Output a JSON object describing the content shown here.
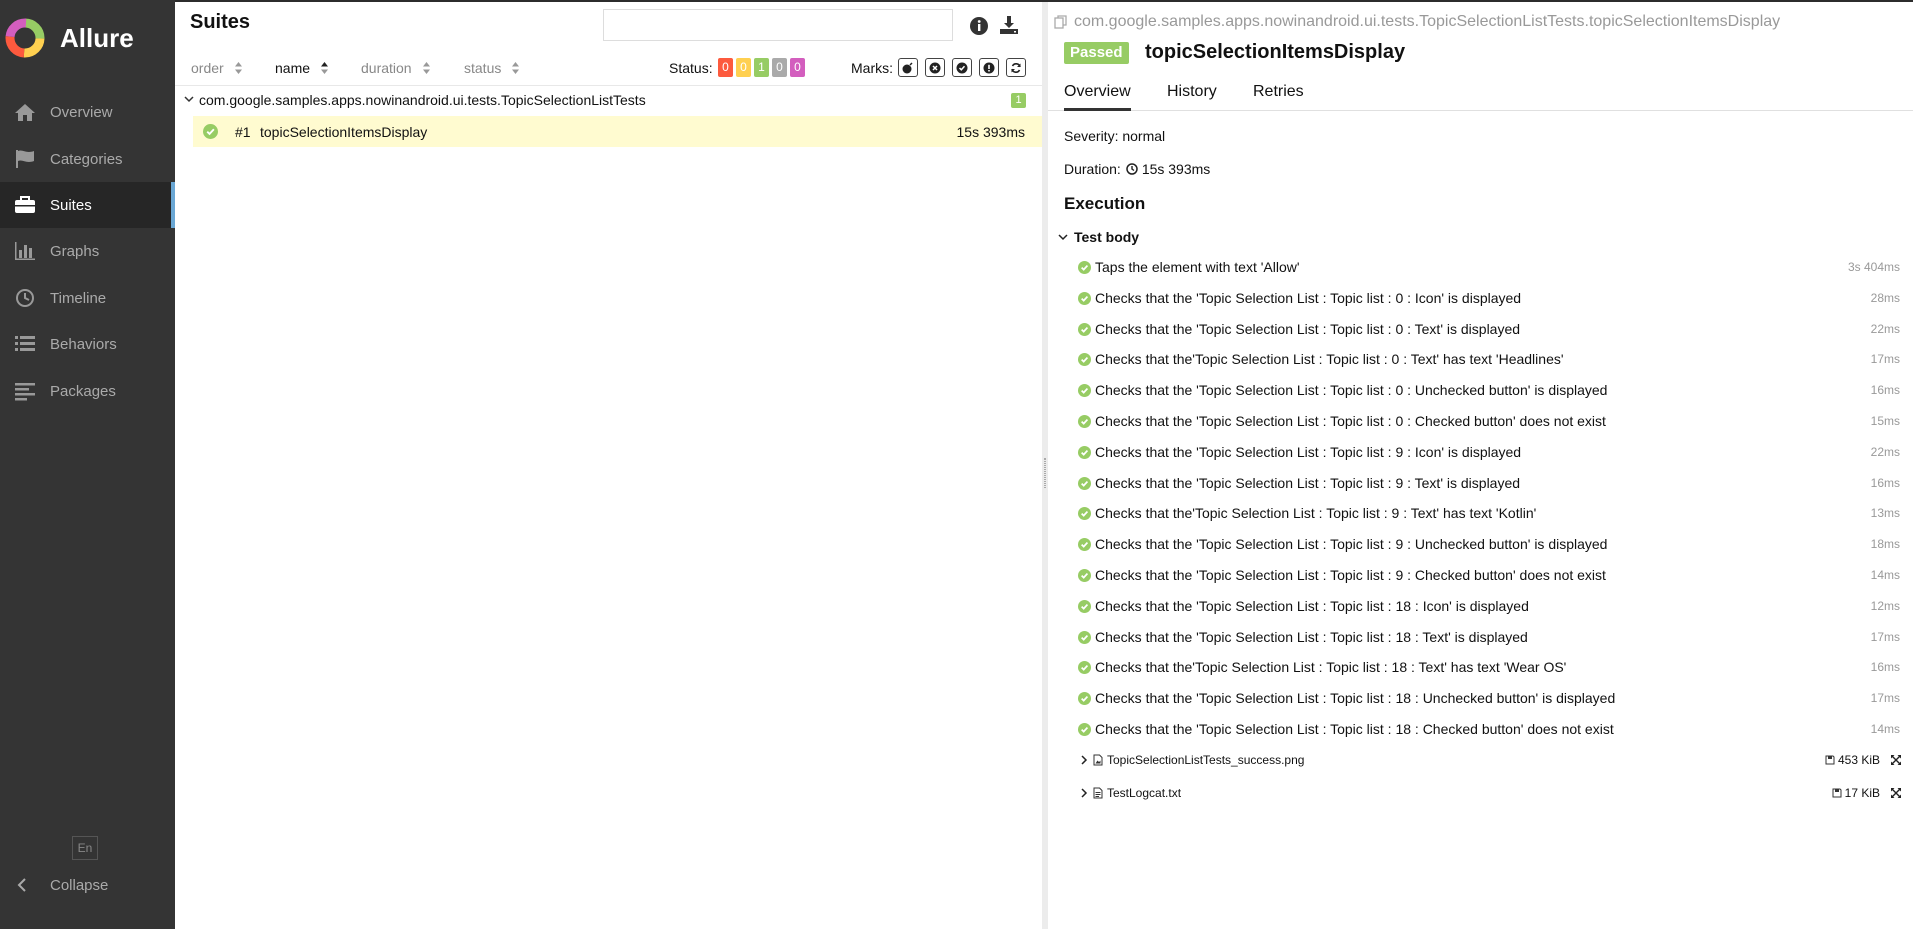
{
  "brand": {
    "name": "Allure"
  },
  "sidebar": {
    "items": [
      {
        "label": "Overview",
        "icon": "home-icon"
      },
      {
        "label": "Categories",
        "icon": "flag-icon"
      },
      {
        "label": "Suites",
        "icon": "briefcase-icon",
        "active": true
      },
      {
        "label": "Graphs",
        "icon": "bar-chart-icon"
      },
      {
        "label": "Timeline",
        "icon": "clock-icon"
      },
      {
        "label": "Behaviors",
        "icon": "list-icon"
      },
      {
        "label": "Packages",
        "icon": "align-left-icon"
      }
    ],
    "language": "En",
    "collapse_label": "Collapse"
  },
  "suites": {
    "title": "Suites",
    "search_value": "",
    "sort": {
      "order": "order",
      "name": "name",
      "duration": "duration",
      "status": "status"
    },
    "status_label": "Status:",
    "status_counts": [
      {
        "value": "0",
        "color": "#fd5a3e"
      },
      {
        "value": "0",
        "color": "#ffd050"
      },
      {
        "value": "1",
        "color": "#97cc64"
      },
      {
        "value": "0",
        "color": "#aaaaaa"
      },
      {
        "value": "0",
        "color": "#d35ebe"
      }
    ],
    "marks_label": "Marks:",
    "suite_name": "com.google.samples.apps.nowinandroid.ui.tests.TopicSelectionListTests",
    "suite_count": "1",
    "test": {
      "num": "#1",
      "name": "topicSelectionItemsDisplay",
      "duration": "15s 393ms"
    }
  },
  "detail": {
    "path": "com.google.samples.apps.nowinandroid.ui.tests.TopicSelectionListTests.topicSelectionItemsDisplay",
    "status": "Passed",
    "title": "topicSelectionItemsDisplay",
    "tabs": [
      "Overview",
      "History",
      "Retries"
    ],
    "severity": "Severity: normal",
    "duration_label": "Duration:",
    "duration": "15s 393ms",
    "execution_title": "Execution",
    "test_body_label": "Test body",
    "steps": [
      {
        "text": "Taps the element with text 'Allow'",
        "duration": "3s 404ms"
      },
      {
        "text": "Checks that the 'Topic Selection List : Topic list : 0 : Icon' is displayed",
        "duration": "28ms"
      },
      {
        "text": "Checks that the 'Topic Selection List : Topic list : 0 : Text' is displayed",
        "duration": "22ms"
      },
      {
        "text": "Checks that the'Topic Selection List : Topic list : 0 : Text' has text 'Headlines'",
        "duration": "17ms"
      },
      {
        "text": "Checks that the 'Topic Selection List : Topic list : 0 : Unchecked button' is displayed",
        "duration": "16ms"
      },
      {
        "text": "Checks that the 'Topic Selection List : Topic list : 0 : Checked button' does not exist",
        "duration": "15ms"
      },
      {
        "text": "Checks that the 'Topic Selection List : Topic list : 9 : Icon' is displayed",
        "duration": "22ms"
      },
      {
        "text": "Checks that the 'Topic Selection List : Topic list : 9 : Text' is displayed",
        "duration": "16ms"
      },
      {
        "text": "Checks that the'Topic Selection List : Topic list : 9 : Text' has text 'Kotlin'",
        "duration": "13ms"
      },
      {
        "text": "Checks that the 'Topic Selection List : Topic list : 9 : Unchecked button' is displayed",
        "duration": "18ms"
      },
      {
        "text": "Checks that the 'Topic Selection List : Topic list : 9 : Checked button' does not exist",
        "duration": "14ms"
      },
      {
        "text": "Checks that the 'Topic Selection List : Topic list : 18 : Icon' is displayed",
        "duration": "12ms"
      },
      {
        "text": "Checks that the 'Topic Selection List : Topic list : 18 : Text' is displayed",
        "duration": "17ms"
      },
      {
        "text": "Checks that the'Topic Selection List : Topic list : 18 : Text' has text 'Wear OS'",
        "duration": "16ms"
      },
      {
        "text": "Checks that the 'Topic Selection List : Topic list : 18 : Unchecked button' is displayed",
        "duration": "17ms"
      },
      {
        "text": "Checks that the 'Topic Selection List : Topic list : 18 : Checked button' does not exist",
        "duration": "14ms"
      }
    ],
    "attachments": [
      {
        "name": "TopicSelectionListTests_success.png",
        "size": "453 KiB",
        "icon": "image-file-icon"
      },
      {
        "name": "TestLogcat.txt",
        "size": "17 KiB",
        "icon": "text-file-icon"
      }
    ]
  }
}
